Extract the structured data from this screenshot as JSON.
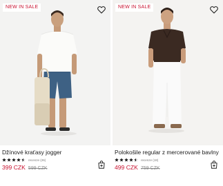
{
  "products": [
    {
      "badge": "NEW IN SALE",
      "title": "Džínové kraťasy jogger",
      "rating": 4.5,
      "reviews_text": "recenze (26)",
      "price": "399 CZK",
      "old_price": "599 CZK",
      "icons": {
        "wishlist": "heart-outline-icon",
        "cart": "shopping-bag-add-icon",
        "star": "star-icon"
      }
    },
    {
      "badge": "NEW IN SALE",
      "title": "Polokošile regular z mercerované bavlny",
      "rating": 4.5,
      "reviews_text": "recenze (18)",
      "price": "499 CZK",
      "old_price": "759 CZK",
      "icons": {
        "wishlist": "heart-outline-icon",
        "cart": "shopping-bag-add-icon",
        "star": "star-icon"
      }
    }
  ],
  "colors": {
    "sale_red": "#c8102e",
    "text": "#1a1a1a",
    "muted": "#8a8a8a",
    "photo_bg": "#f3f3f2"
  }
}
